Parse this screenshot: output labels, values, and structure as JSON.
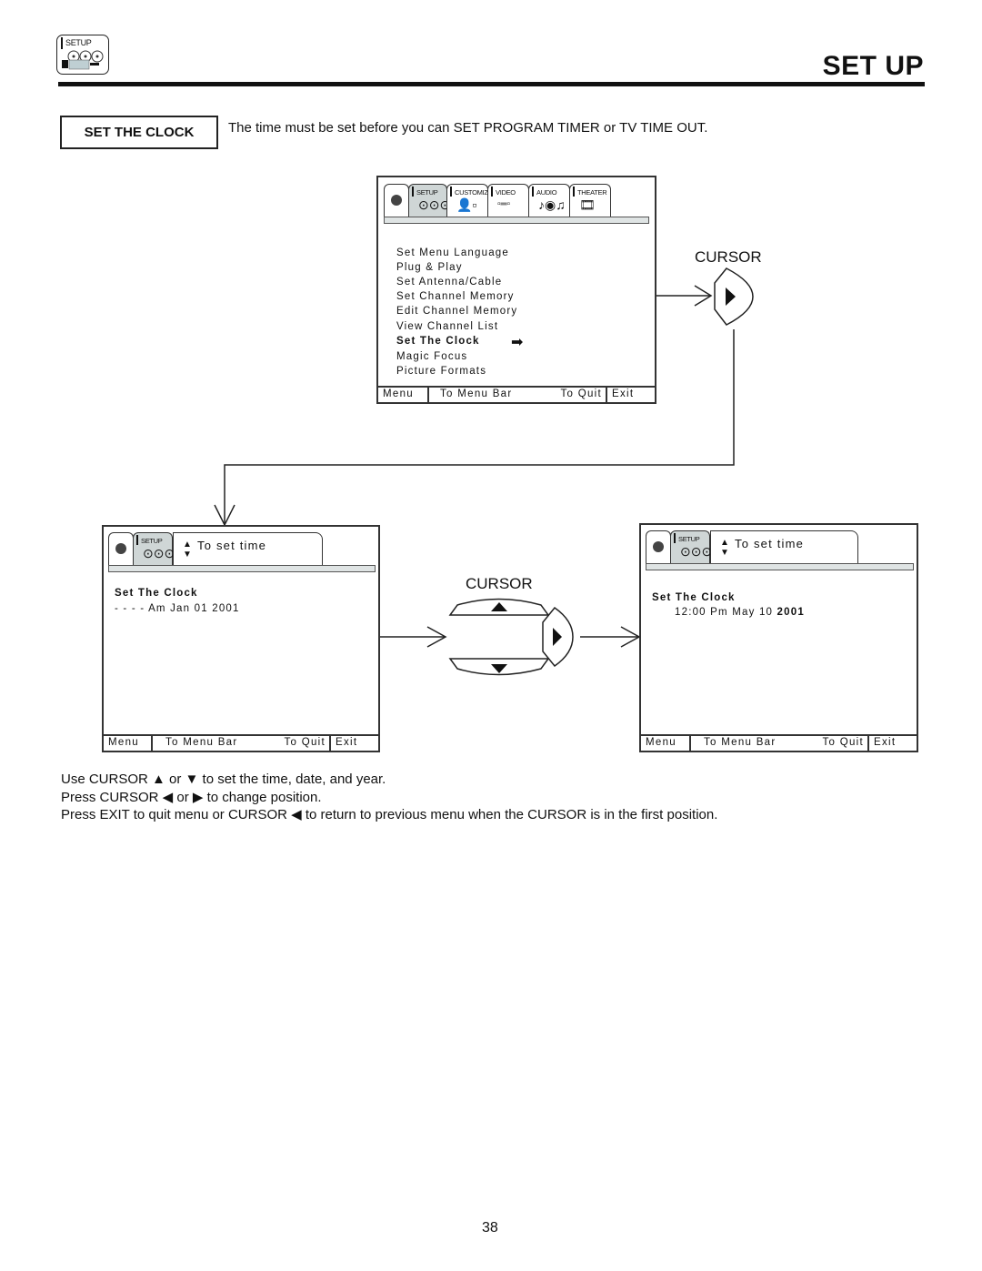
{
  "header": {
    "icon_label": "SETUP",
    "page_title": "SET UP"
  },
  "section": {
    "title": "SET THE CLOCK",
    "intro": "The time must be set before you can  SET PROGRAM TIMER or TV TIME OUT."
  },
  "main_menu": {
    "tabs": [
      {
        "label": "SETUP",
        "icon": "setup-icon",
        "selected": true
      },
      {
        "label": "CUSTOMIZE",
        "icon": "customize-icon",
        "selected": false
      },
      {
        "label": "VIDEO",
        "icon": "video-sliders-icon",
        "selected": false
      },
      {
        "label": "AUDIO",
        "icon": "audio-icon",
        "selected": false
      },
      {
        "label": "THEATER",
        "icon": "theater-icon",
        "selected": false
      }
    ],
    "items": [
      {
        "label": "Set Menu Language",
        "selected": false
      },
      {
        "label": "Plug & Play",
        "selected": false
      },
      {
        "label": "Set Antenna/Cable",
        "selected": false
      },
      {
        "label": "Set Channel Memory",
        "selected": false
      },
      {
        "label": "Edit Channel Memory",
        "selected": false
      },
      {
        "label": "View Channel List",
        "selected": false
      },
      {
        "label": "Set The Clock",
        "selected": true
      },
      {
        "label": "Magic Focus",
        "selected": false
      },
      {
        "label": "Picture Formats",
        "selected": false
      }
    ],
    "footer": {
      "menu": "Menu",
      "to_menu_bar": "To Menu Bar",
      "to_quit": "To Quit",
      "exit": "Exit"
    }
  },
  "cursor_label": "CURSOR",
  "clock_before": {
    "tab_label": "SETUP",
    "hint": "To set time",
    "title": "Set The Clock",
    "value": "- -  - - Am Jan 01 2001",
    "footer": {
      "menu": "Menu",
      "to_menu_bar": "To Menu Bar",
      "to_quit": "To Quit",
      "exit": "Exit"
    }
  },
  "clock_after": {
    "tab_label": "SETUP",
    "hint": "To set time",
    "title": "Set The Clock",
    "value_prefix": "12:00 Pm May 10 ",
    "value_year": "2001",
    "footer": {
      "menu": "Menu",
      "to_menu_bar": "To Menu Bar",
      "to_quit": "To Quit",
      "exit": "Exit"
    }
  },
  "instructions": [
    "Use CURSOR ▲ or ▼ to set the time, date, and year.",
    "Press CURSOR ◀ or ▶ to change position.",
    "Press EXIT to quit menu or CURSOR ◀ to return to previous menu when the CURSOR is in the first position."
  ],
  "page_number": "38"
}
